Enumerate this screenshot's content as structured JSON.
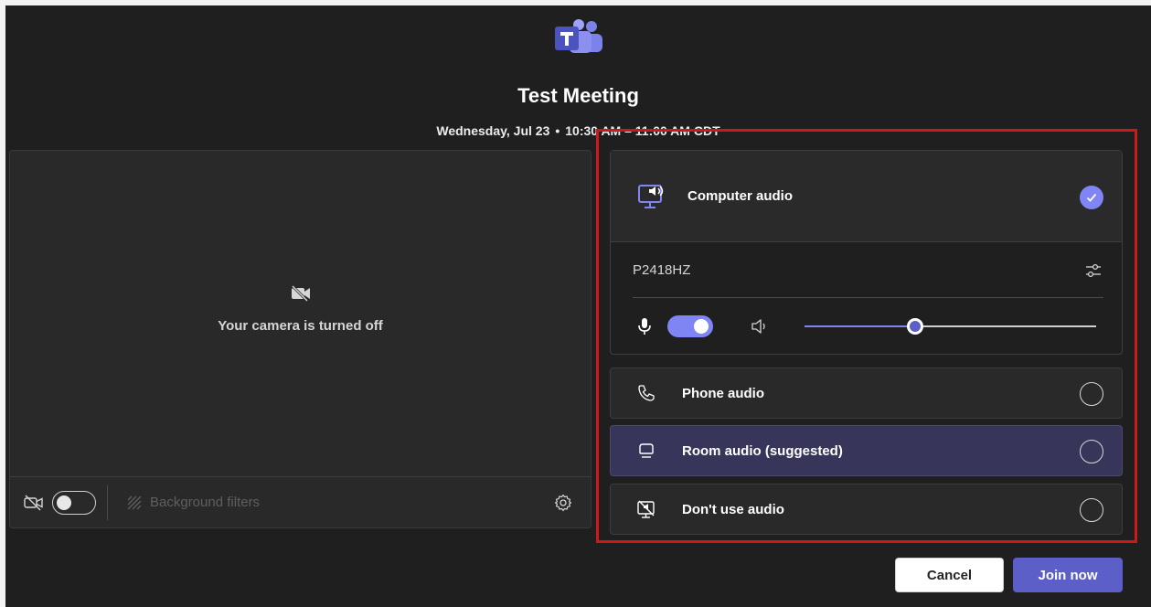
{
  "meeting": {
    "title": "Test Meeting",
    "date": "Wednesday, Jul 23",
    "separator": "•",
    "time": "10:30 AM – 11:00 AM CDT"
  },
  "camera": {
    "status_text": "Your camera is turned off",
    "background_filters_label": "Background filters",
    "camera_toggle": "off"
  },
  "audio": {
    "selected": "computer_audio",
    "computer_audio": {
      "label": "Computer audio",
      "device_name": "P2418HZ",
      "mic_toggle": "on",
      "volume_level": 0.38
    },
    "options": [
      {
        "label": "Phone audio",
        "icon": "phone-icon",
        "selected": false
      },
      {
        "label": "Room audio (suggested)",
        "icon": "room-audio-icon",
        "selected": false,
        "highlighted": true
      },
      {
        "label": "Don't use audio",
        "icon": "no-audio-icon",
        "selected": false
      }
    ]
  },
  "buttons": {
    "cancel": "Cancel",
    "join": "Join now"
  },
  "colors": {
    "accent": "#7f85f5",
    "primary_button": "#5b5fc7",
    "background": "#1f1f1f",
    "highlight": "#d01818"
  }
}
